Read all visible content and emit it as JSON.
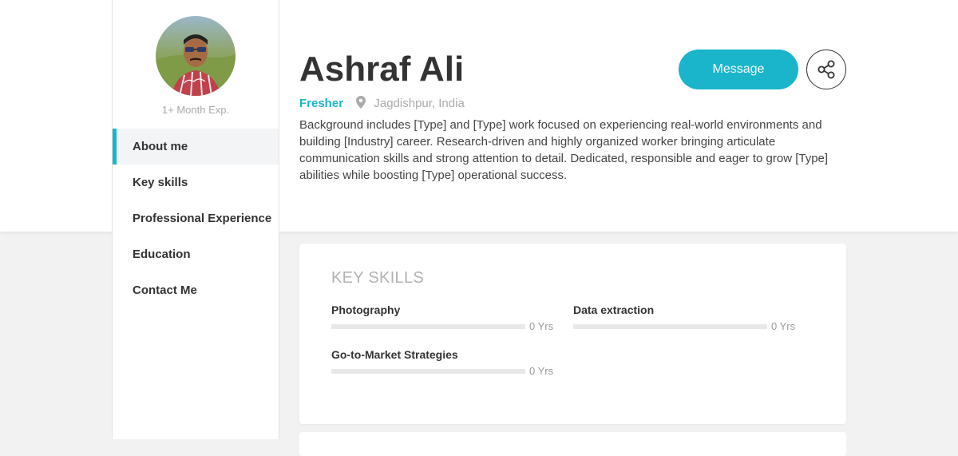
{
  "profile": {
    "experience": "1+ Month Exp.",
    "name": "Ashraf Ali",
    "status": "Fresher",
    "location": "Jagdishpur, India",
    "about": "Background includes [Type] and [Type] work focused on experiencing real-world environments and building [Industry] career. Research-driven and highly organized worker bringing articulate communication skills and strong attention to detail. Dedicated, responsible and eager to grow [Type] abilities while boosting [Type] operational success."
  },
  "actions": {
    "message_label": "Message",
    "share_icon": "share-icon"
  },
  "sidebar": {
    "items": [
      {
        "label": "About me",
        "active": true
      },
      {
        "label": "Key skills",
        "active": false
      },
      {
        "label": "Professional Experience",
        "active": false
      },
      {
        "label": "Education",
        "active": false
      },
      {
        "label": "Contact Me",
        "active": false
      }
    ]
  },
  "key_skills": {
    "title": "KEY SKILLS",
    "items": [
      {
        "name": "Photography",
        "years": "0 Yrs",
        "level": 0
      },
      {
        "name": "Data extraction",
        "years": "0 Yrs",
        "level": 0
      },
      {
        "name": "Go-to-Market Strategies",
        "years": "0 Yrs",
        "level": 0
      }
    ]
  },
  "colors": {
    "accent": "#1ab5cb",
    "text": "#333333",
    "muted": "#aaaaaa",
    "page_bg": "#f2f2f2"
  }
}
